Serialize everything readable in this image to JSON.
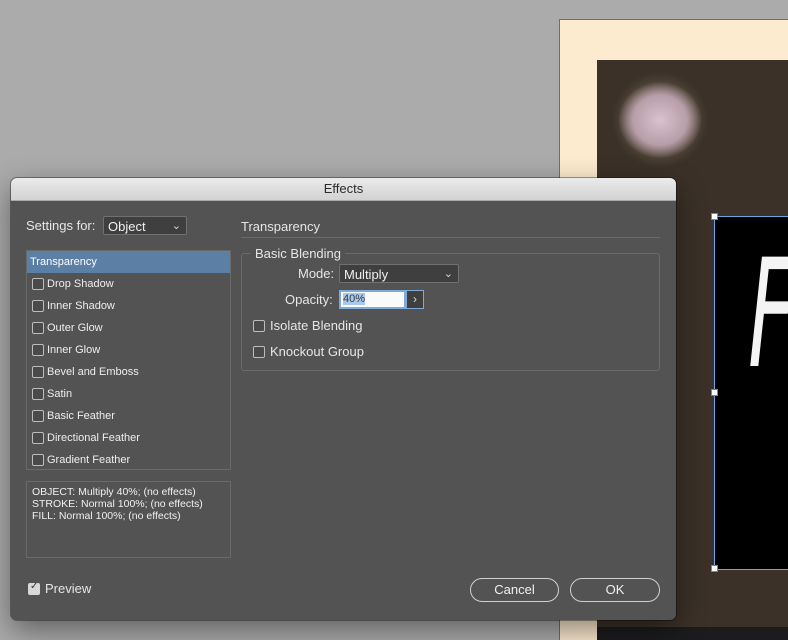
{
  "dialog": {
    "title": "Effects",
    "settings_for": {
      "label": "Settings for:",
      "value": "Object"
    },
    "effects_list": [
      {
        "label": "Transparency",
        "selected": true,
        "has_checkbox": false
      },
      {
        "label": "Drop Shadow",
        "checked": false
      },
      {
        "label": "Inner Shadow",
        "checked": false
      },
      {
        "label": "Outer Glow",
        "checked": false
      },
      {
        "label": "Inner Glow",
        "checked": false
      },
      {
        "label": "Bevel and Emboss",
        "checked": false
      },
      {
        "label": "Satin",
        "checked": false
      },
      {
        "label": "Basic Feather",
        "checked": false
      },
      {
        "label": "Directional Feather",
        "checked": false
      },
      {
        "label": "Gradient Feather",
        "checked": false
      }
    ],
    "summary": [
      "OBJECT: Multiply 40%; (no effects)",
      "STROKE: Normal 100%; (no effects)",
      "FILL: Normal 100%; (no effects)"
    ],
    "panel": {
      "section_title": "Transparency",
      "group_title": "Basic Blending",
      "mode": {
        "label": "Mode:",
        "value": "Multiply"
      },
      "opacity": {
        "label": "Opacity:",
        "value": "40%"
      },
      "isolate_blending": {
        "label": "Isolate Blending",
        "checked": false
      },
      "knockout_group": {
        "label": "Knockout Group",
        "checked": false
      }
    },
    "preview": {
      "label": "Preview",
      "checked": true
    },
    "buttons": {
      "cancel": "Cancel",
      "ok": "OK"
    }
  },
  "colors": {
    "dialog_bg": "#535353",
    "selection": "#5c7fa5",
    "focus_ring": "#7fa9d8",
    "canvas_bg": "#ababab",
    "page_bg": "#fdebcf"
  },
  "icons": {
    "chevron_down": "chevron-down-icon",
    "chevron_right": "chevron-right-icon",
    "checkmark": "checkmark-icon"
  }
}
